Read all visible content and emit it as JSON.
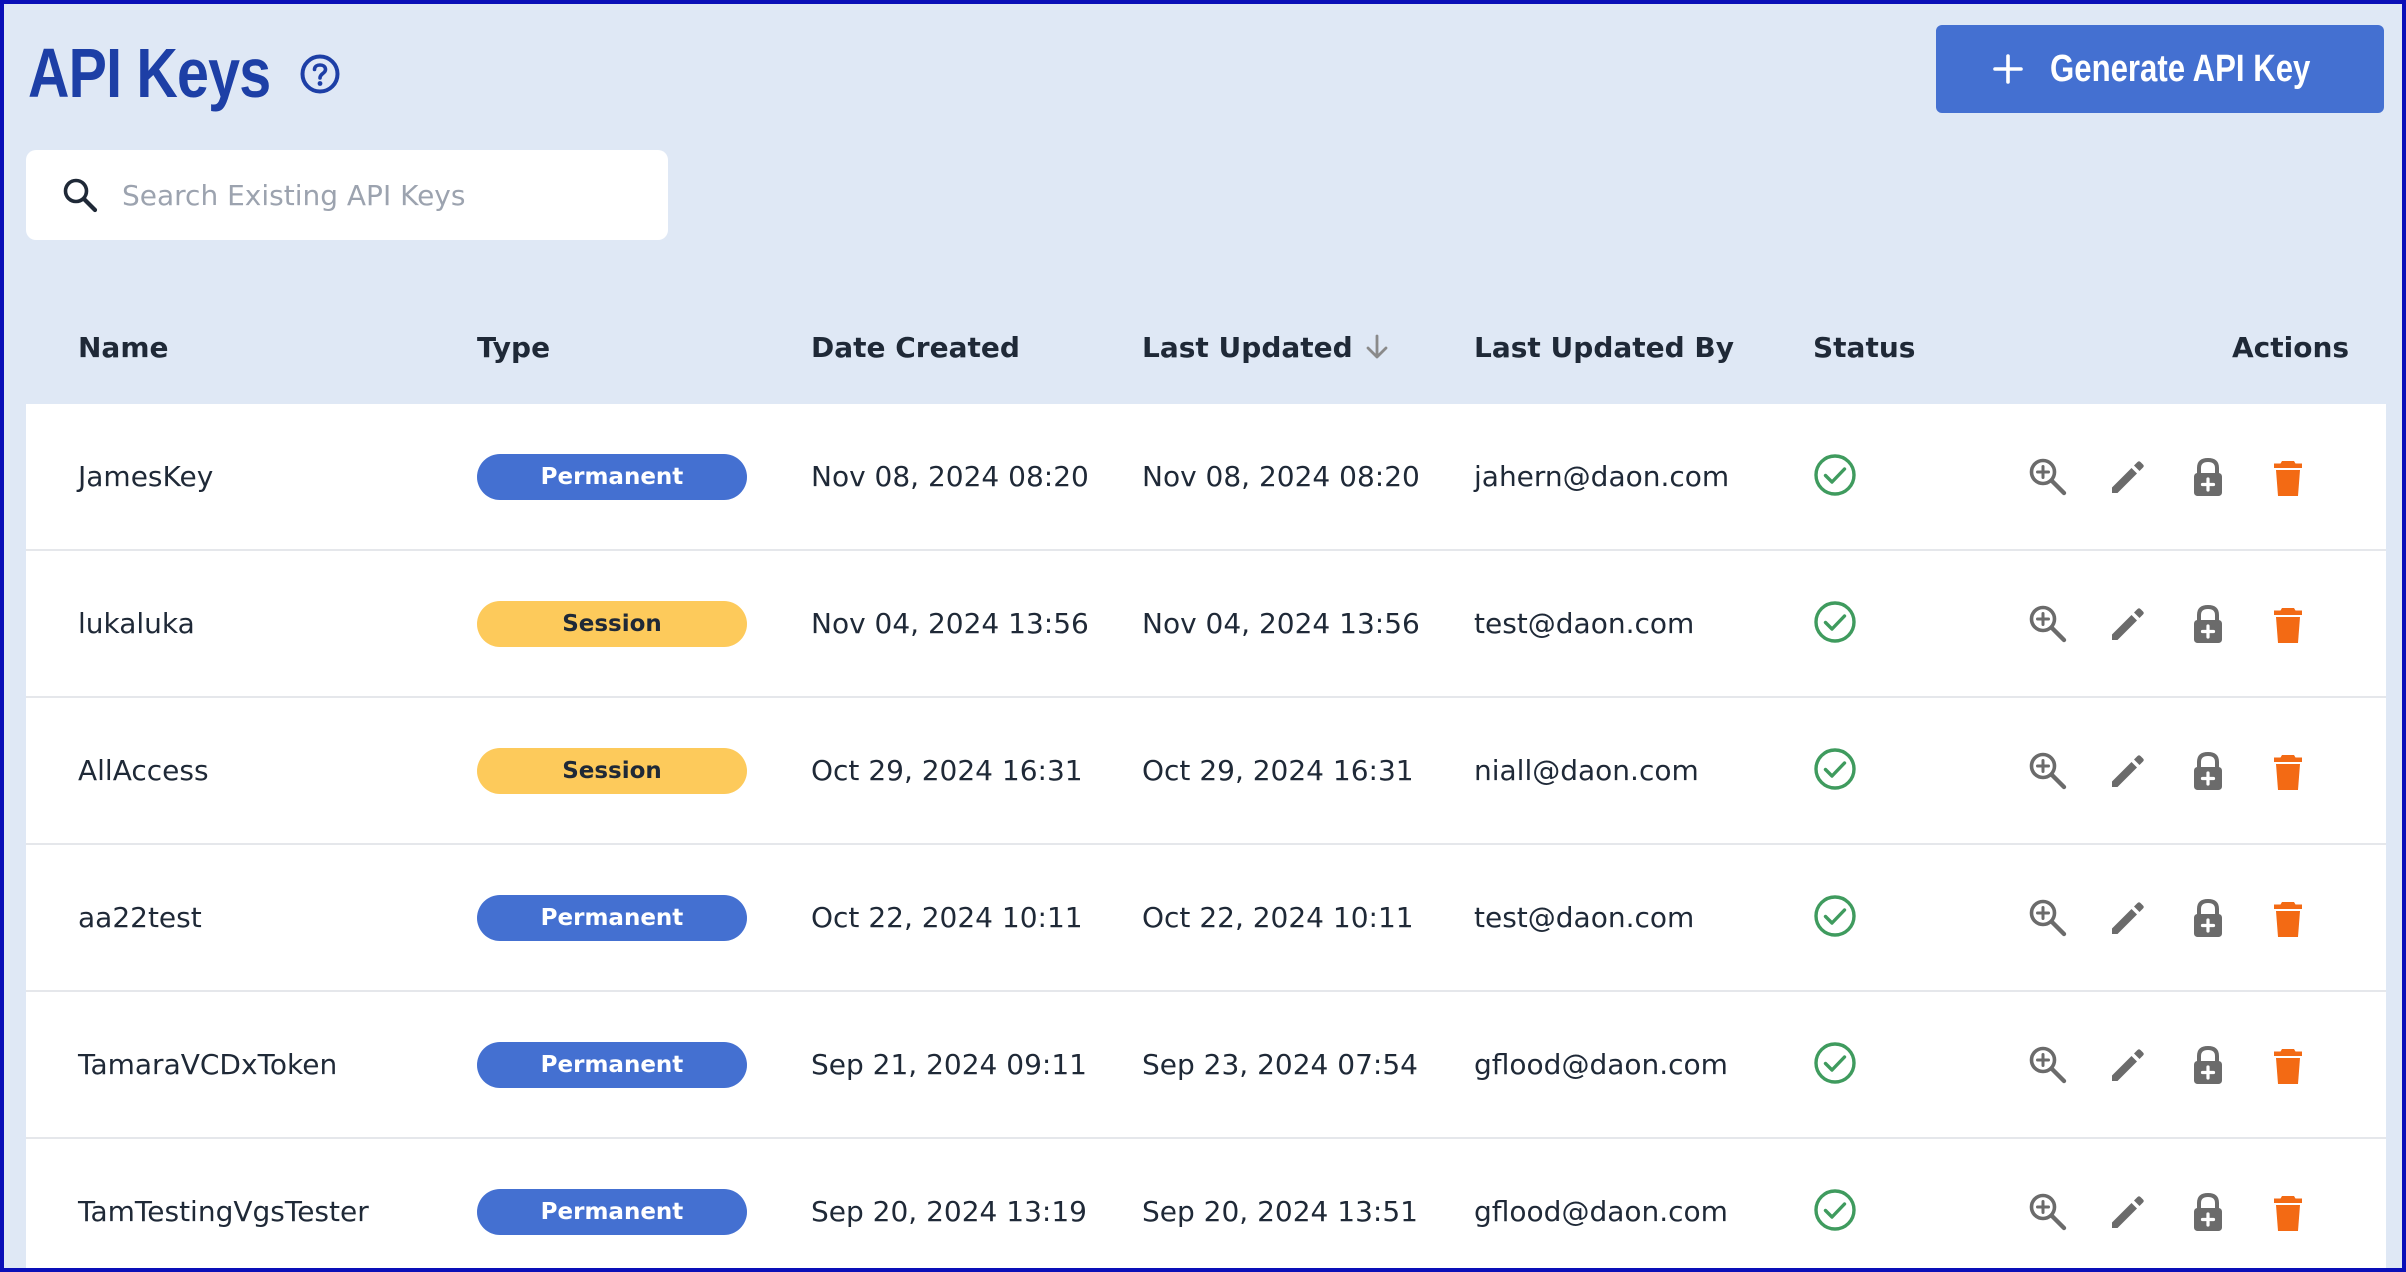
{
  "header": {
    "title": "API Keys",
    "generate_button_label": "Generate API Key"
  },
  "search": {
    "placeholder": "Search Existing API Keys",
    "value": ""
  },
  "table": {
    "columns": {
      "name": "Name",
      "type": "Type",
      "date_created": "Date Created",
      "last_updated": "Last Updated",
      "last_updated_by": "Last Updated By",
      "status": "Status",
      "actions": "Actions"
    },
    "sorted_by": "Last Updated",
    "sort_direction": "descending",
    "rows": [
      {
        "name": "JamesKey",
        "type": "Permanent",
        "date_created": "Nov 08, 2024 08:20",
        "last_updated": "Nov 08, 2024 08:20",
        "last_updated_by": "jahern@daon.com",
        "status": "active"
      },
      {
        "name": "lukaluka",
        "type": "Session",
        "date_created": "Nov 04, 2024 13:56",
        "last_updated": "Nov 04, 2024 13:56",
        "last_updated_by": "test@daon.com",
        "status": "active"
      },
      {
        "name": "AllAccess",
        "type": "Session",
        "date_created": "Oct 29, 2024 16:31",
        "last_updated": "Oct 29, 2024 16:31",
        "last_updated_by": "niall@daon.com",
        "status": "active"
      },
      {
        "name": "aa22test",
        "type": "Permanent",
        "date_created": "Oct 22, 2024 10:11",
        "last_updated": "Oct 22, 2024 10:11",
        "last_updated_by": "test@daon.com",
        "status": "active"
      },
      {
        "name": "TamaraVCDxToken",
        "type": "Permanent",
        "date_created": "Sep 21, 2024 09:11",
        "last_updated": "Sep 23, 2024 07:54",
        "last_updated_by": "gflood@daon.com",
        "status": "active"
      },
      {
        "name": "TamTestingVgsTester",
        "type": "Permanent",
        "date_created": "Sep 20, 2024 13:19",
        "last_updated": "Sep 20, 2024 13:51",
        "last_updated_by": "gflood@daon.com",
        "status": "active"
      }
    ]
  },
  "icons": {
    "help": "help-circle-icon",
    "plus": "plus-icon",
    "search": "search-icon",
    "sort": "arrow-down-icon",
    "status": "check-circle-icon",
    "view": "zoom-in-icon",
    "edit": "pencil-icon",
    "permissions": "lock-plus-icon",
    "delete": "trash-icon"
  },
  "colors": {
    "page_background": "#dfe8f5",
    "title": "#1d3fa6",
    "primary": "#4470d1",
    "session_badge": "#fdca5b",
    "status_ok": "#3f9b5e",
    "action_icon": "#6b6b6b",
    "delete_icon": "#f36a14",
    "frame_border": "#0a0fb8"
  }
}
